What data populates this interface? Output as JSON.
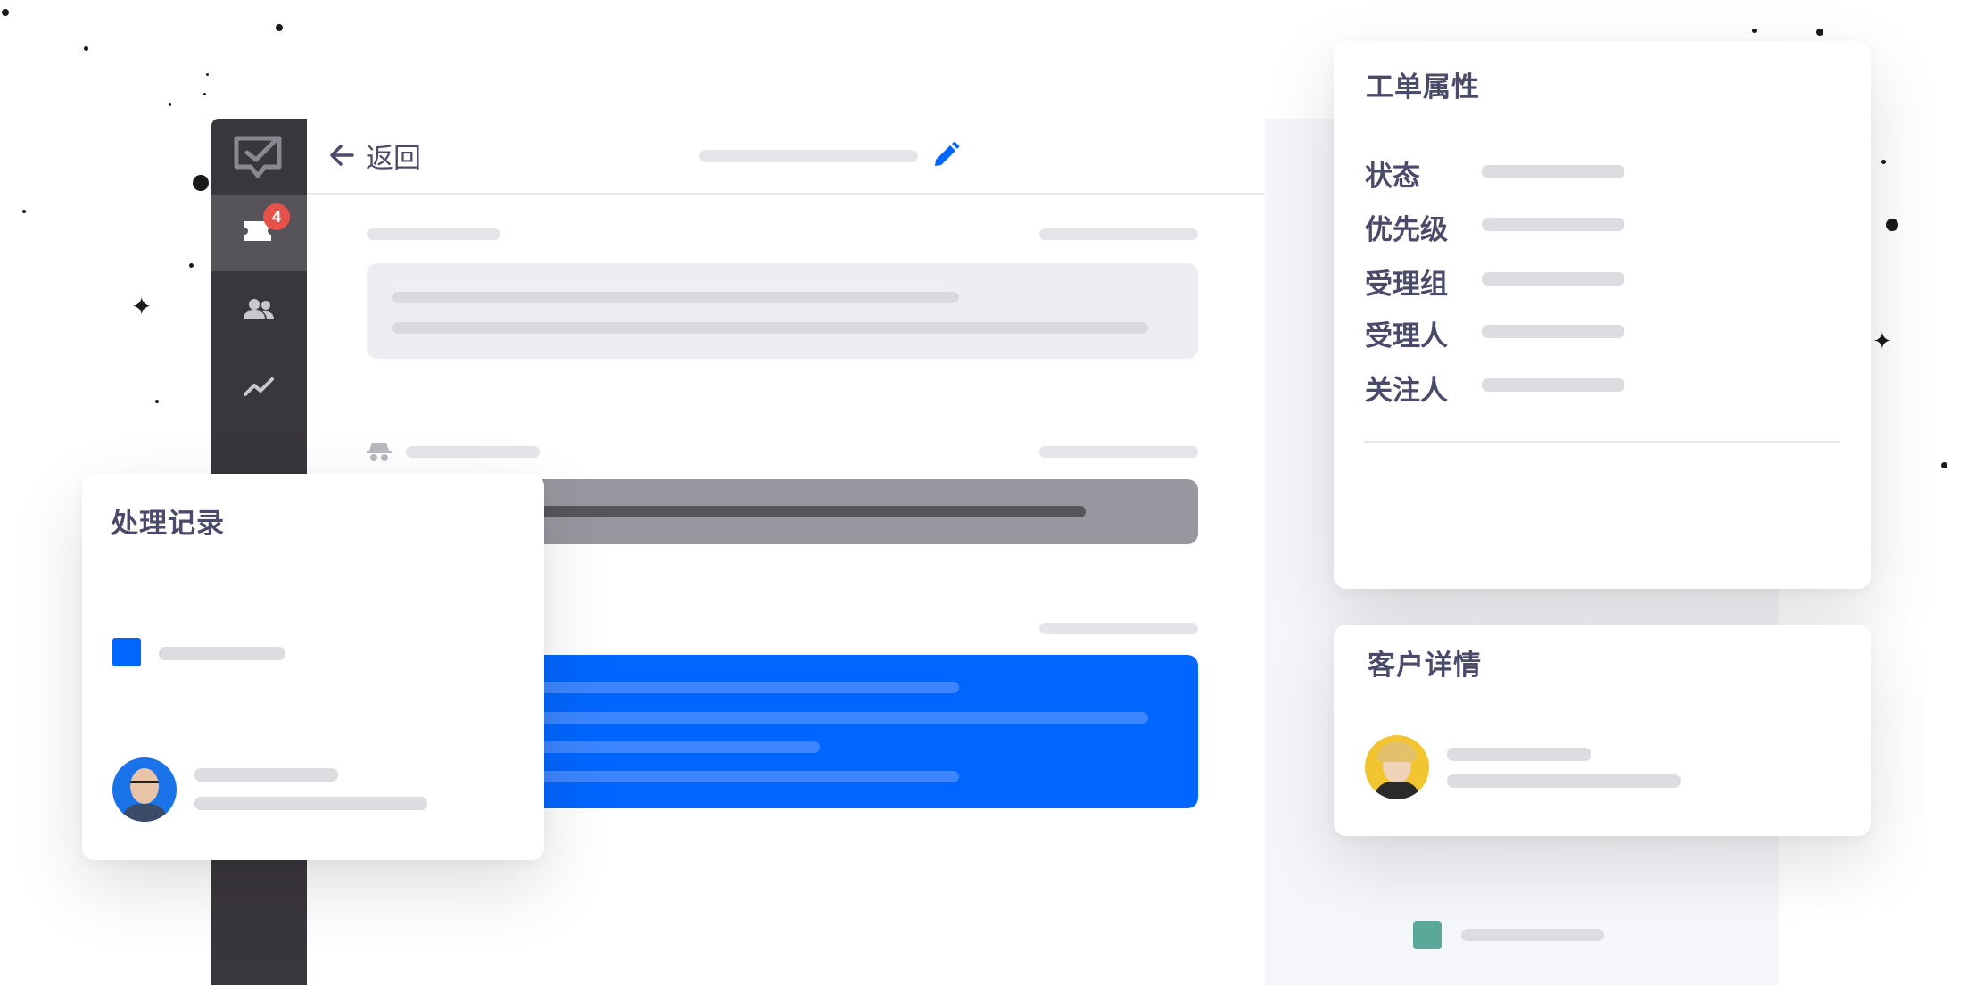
{
  "colors": {
    "accent": "#0066ff",
    "badge": "#e8504a",
    "sidebar_bg": "#3a363d",
    "record_icon": "#0066ff",
    "customer_icon": "#5aa89a"
  },
  "header": {
    "back_label": "返回",
    "back_icon": "arrow-left-icon",
    "edit_icon": "pencil-icon"
  },
  "sidebar": {
    "logo_icon": "message-check-icon",
    "items": [
      {
        "icon": "ticket-icon",
        "badge": "4"
      },
      {
        "icon": "users-icon"
      },
      {
        "icon": "trend-chart-icon"
      }
    ]
  },
  "ticket_props": {
    "title": "工单属性",
    "fields": [
      "状态",
      "优先级",
      "受理组",
      "受理人",
      "关注人"
    ]
  },
  "records": {
    "title": "处理记录"
  },
  "customer": {
    "title": "客户详情"
  },
  "message_icon": "incognito-icon"
}
